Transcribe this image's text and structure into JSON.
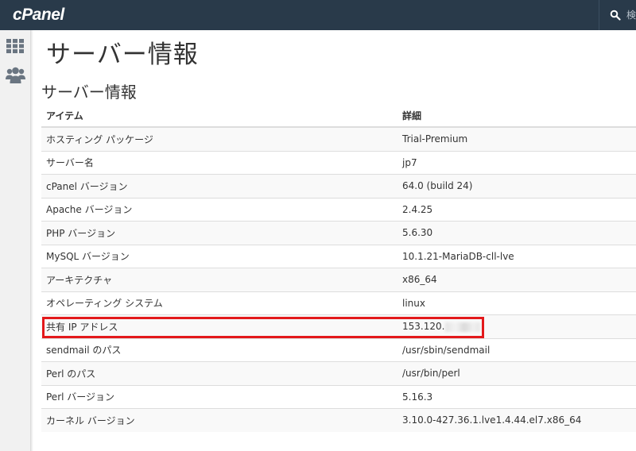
{
  "header": {
    "logo_text": "cPanel",
    "search_placeholder": "検索"
  },
  "sidebar": {
    "items": [
      {
        "icon": "grid-icon"
      },
      {
        "icon": "users-icon"
      }
    ]
  },
  "page_title": "サーバー情報",
  "section_title": "サーバー情報",
  "table": {
    "headers": [
      "アイテム",
      "詳細"
    ],
    "rows": [
      {
        "item": "ホスティング パッケージ",
        "detail": "Trial-Premium"
      },
      {
        "item": "サーバー名",
        "detail": "jp7"
      },
      {
        "item": "cPanel バージョン",
        "detail": "64.0 (build 24)"
      },
      {
        "item": "Apache バージョン",
        "detail": "2.4.25"
      },
      {
        "item": "PHP バージョン",
        "detail": "5.6.30"
      },
      {
        "item": "MySQL バージョン",
        "detail": "10.1.21-MariaDB-cll-lve"
      },
      {
        "item": "アーキテクチャ",
        "detail": "x86_64"
      },
      {
        "item": "オペレーティング システム",
        "detail": "linux"
      },
      {
        "item": "共有 IP アドレス",
        "detail": "153.120."
      },
      {
        "item": "sendmail のパス",
        "detail": "/usr/sbin/sendmail"
      },
      {
        "item": "Perl のパス",
        "detail": "/usr/bin/perl"
      },
      {
        "item": "Perl バージョン",
        "detail": "5.16.3"
      },
      {
        "item": "カーネル バージョン",
        "detail": "3.10.0-427.36.1.lve1.4.44.el7.x86_64"
      }
    ]
  },
  "colors": {
    "topbar": "#293a4a",
    "highlight": "#e3191b"
  }
}
